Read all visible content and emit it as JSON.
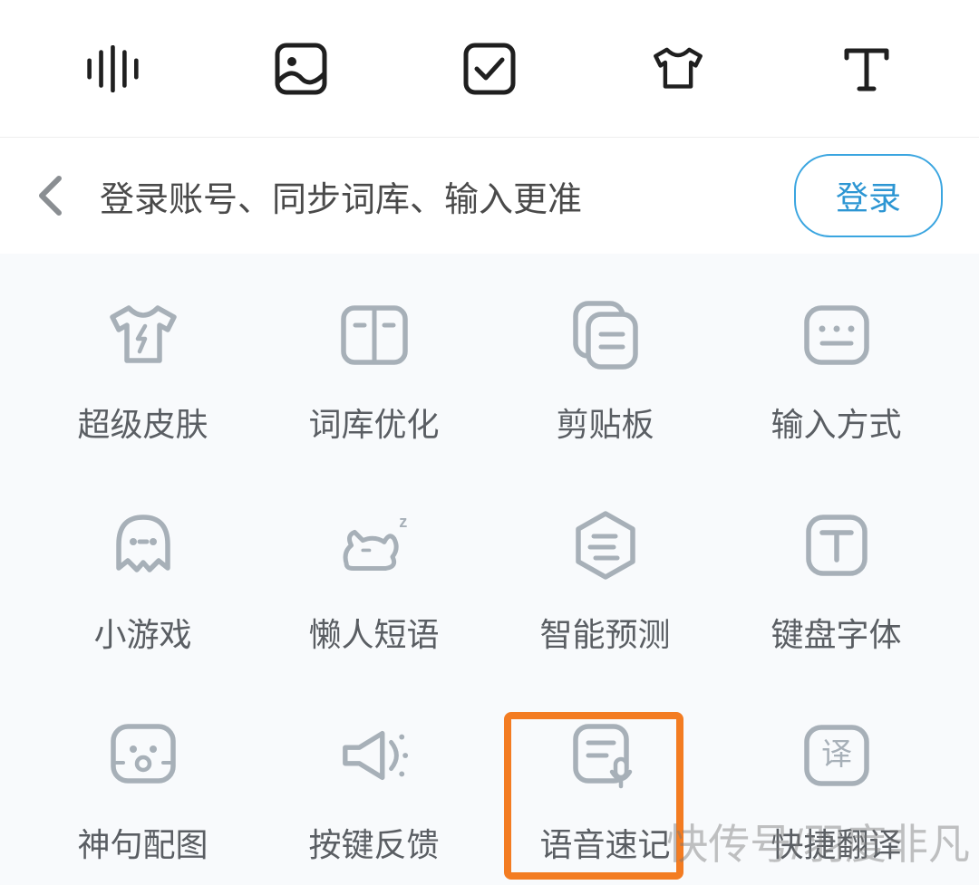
{
  "header": {
    "subtitle": "登录账号、同步词库、输入更准",
    "login_button": "登录"
  },
  "top_icons": [
    "voice-wave-icon",
    "picture-icon",
    "checkbox-icon",
    "shirt-icon",
    "text-t-icon"
  ],
  "tiles": [
    {
      "icon": "shirt-bolt-icon",
      "label": "超级皮肤"
    },
    {
      "icon": "dict-book-icon",
      "label": "词库优化"
    },
    {
      "icon": "clipboard-icon",
      "label": "剪贴板"
    },
    {
      "icon": "input-method-icon",
      "label": "输入方式"
    },
    {
      "icon": "ghost-game-icon",
      "label": "小游戏"
    },
    {
      "icon": "sleep-cat-icon",
      "label": "懒人短语"
    },
    {
      "icon": "hex-predict-icon",
      "label": "智能预测"
    },
    {
      "icon": "keyboard-font-icon",
      "label": "键盘字体"
    },
    {
      "icon": "image-caption-icon",
      "label": "神句配图"
    },
    {
      "icon": "megaphone-icon",
      "label": "按键反馈"
    },
    {
      "icon": "voice-note-icon",
      "label": "语音速记"
    },
    {
      "icon": "translate-icon",
      "label": "快捷翻译"
    }
  ],
  "highlight_index": 10,
  "watermark": "快传号/羽度非凡"
}
